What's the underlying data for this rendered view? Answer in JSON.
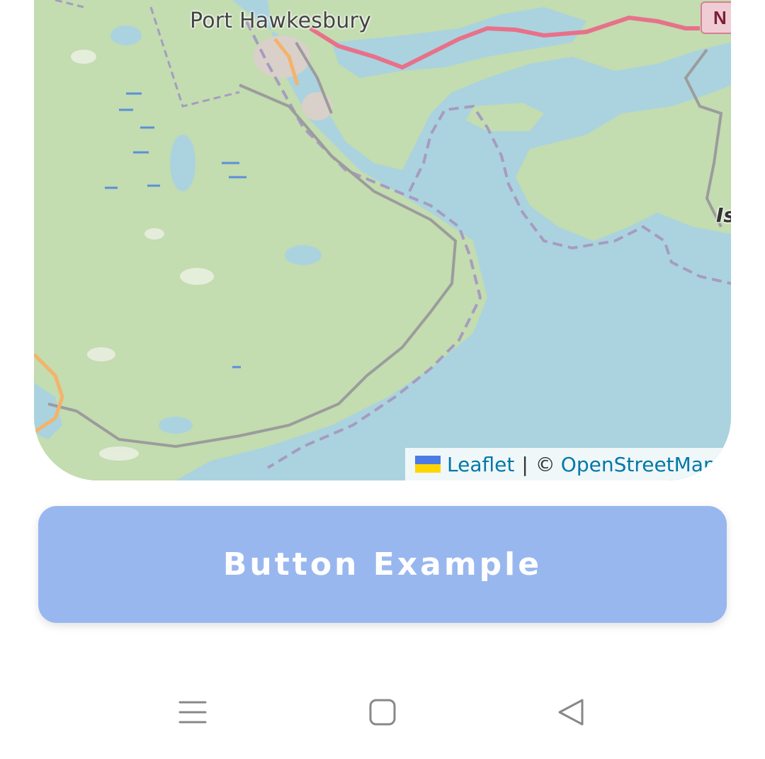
{
  "map": {
    "place_labels": {
      "town": "Port Hawkesbury",
      "partial_place": "Is"
    },
    "route_shield": "N",
    "attribution": {
      "leaflet_label": "Leaflet",
      "separator": "|",
      "copyright_symbol": "©",
      "osm_label": "OpenStreetMap"
    },
    "colors": {
      "land": "#c3dcb0",
      "water": "#aad3df",
      "primary_road": "#e8718a",
      "secondary_road": "#f4b36a"
    }
  },
  "button": {
    "label": "Button Example",
    "color": "#99b7ef"
  },
  "navbar": {
    "menu_icon": "menu-icon",
    "home_icon": "home-square-icon",
    "back_icon": "back-triangle-icon"
  }
}
